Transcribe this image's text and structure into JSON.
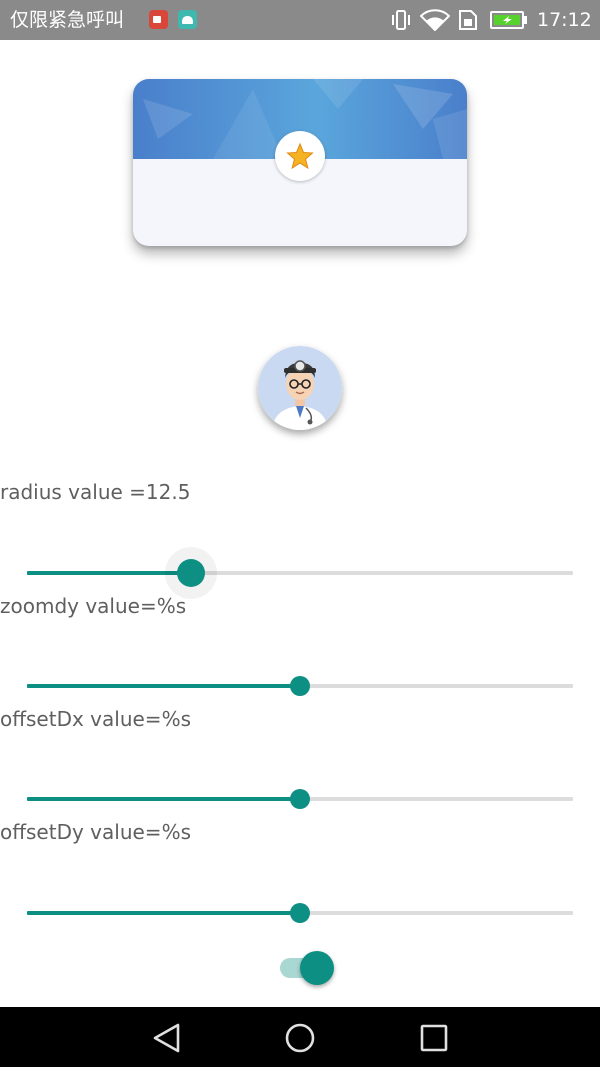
{
  "status_bar": {
    "title": "仅限紧急呼叫",
    "time": "17:12",
    "notification_icons": [
      "video-record-icon",
      "android-icon"
    ],
    "system_icons": [
      "vibrate-icon",
      "wifi-icon",
      "sim-icon",
      "battery-charging-icon"
    ]
  },
  "card": {
    "banner_color": "#4f87cf",
    "icon": "star-icon",
    "star_color": "#f5b324"
  },
  "avatar": {
    "icon": "doctor-avatar-icon"
  },
  "controls": {
    "radius_label": "radius value =12.5",
    "zoomdy_label": "zoomdy  value=%s",
    "offsetdx_label": "offsetDx  value=%s",
    "offsetdy_label": "offsetDy value=%s",
    "sliders": [
      {
        "name": "radius",
        "fraction": 0.3
      },
      {
        "name": "zoomdy",
        "fraction": 0.5
      },
      {
        "name": "offsetdx",
        "fraction": 0.5
      },
      {
        "name": "offsetdy",
        "fraction": 0.5
      }
    ],
    "switch_on": true
  },
  "accent_color": "#0e8f83",
  "nav_bar": {
    "buttons": [
      "back-icon",
      "home-icon",
      "recent-apps-icon"
    ]
  }
}
